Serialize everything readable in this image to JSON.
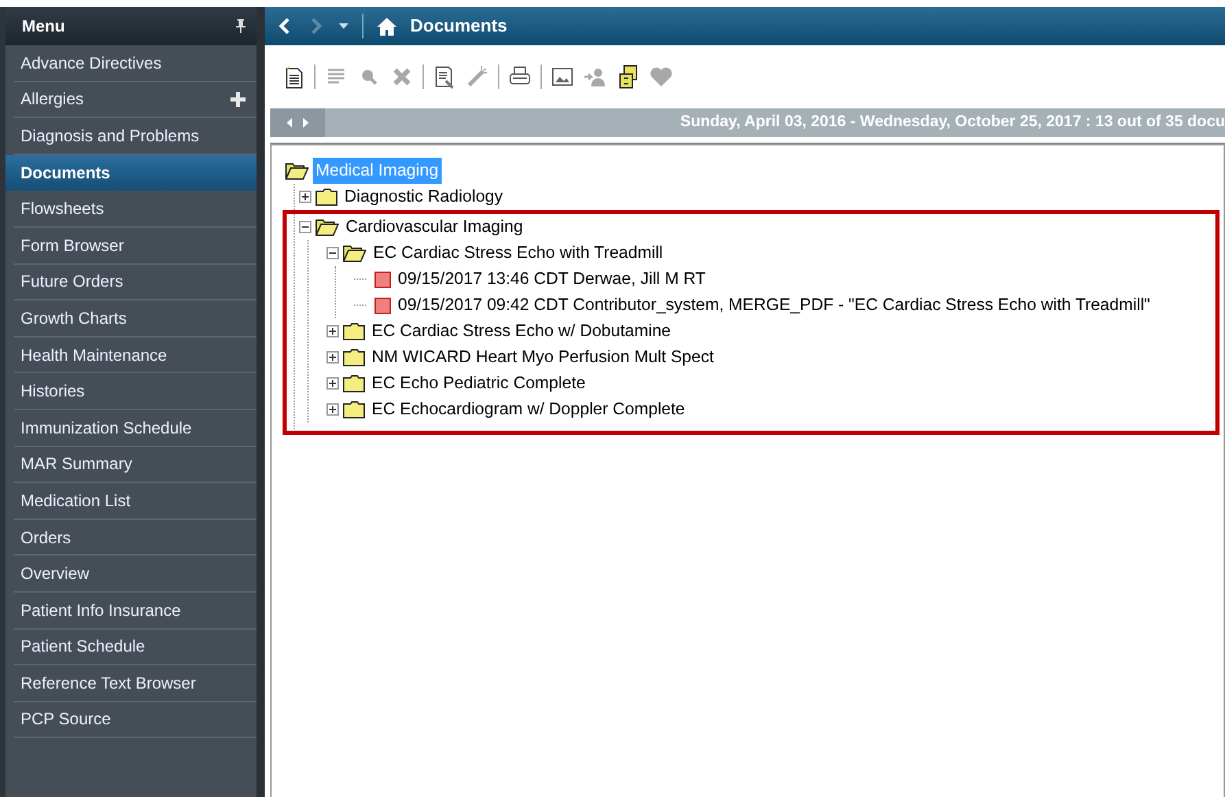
{
  "sidebar": {
    "title": "Menu",
    "items": [
      {
        "label": "Advance Directives",
        "selected": false,
        "addable": false
      },
      {
        "label": "Allergies",
        "selected": false,
        "addable": true
      },
      {
        "label": "Diagnosis and Problems",
        "selected": false,
        "addable": false
      },
      {
        "label": "Documents",
        "selected": true,
        "addable": false
      },
      {
        "label": "Flowsheets",
        "selected": false,
        "addable": false
      },
      {
        "label": "Form Browser",
        "selected": false,
        "addable": false
      },
      {
        "label": "Future Orders",
        "selected": false,
        "addable": false
      },
      {
        "label": "Growth Charts",
        "selected": false,
        "addable": false
      },
      {
        "label": "Health Maintenance",
        "selected": false,
        "addable": false
      },
      {
        "label": "Histories",
        "selected": false,
        "addable": false
      },
      {
        "label": "Immunization Schedule",
        "selected": false,
        "addable": false
      },
      {
        "label": "MAR Summary",
        "selected": false,
        "addable": false
      },
      {
        "label": "Medication List",
        "selected": false,
        "addable": false
      },
      {
        "label": "Orders",
        "selected": false,
        "addable": false
      },
      {
        "label": "Overview",
        "selected": false,
        "addable": false
      },
      {
        "label": "Patient Info Insurance",
        "selected": false,
        "addable": false
      },
      {
        "label": "Patient Schedule",
        "selected": false,
        "addable": false
      },
      {
        "label": "Reference Text Browser",
        "selected": false,
        "addable": false
      },
      {
        "label": "PCP Source",
        "selected": false,
        "addable": false
      }
    ]
  },
  "header": {
    "title": "Documents",
    "nav": [
      {
        "kind": "back",
        "disabled": false
      },
      {
        "kind": "forward",
        "disabled": true
      }
    ]
  },
  "toolbar": [
    {
      "kind": "new-document",
      "disabled": false
    },
    {
      "kind": "separator"
    },
    {
      "kind": "list",
      "disabled": true
    },
    {
      "kind": "search",
      "disabled": true
    },
    {
      "kind": "delete",
      "disabled": true
    },
    {
      "kind": "separator"
    },
    {
      "kind": "document",
      "disabled": false
    },
    {
      "kind": "wand",
      "disabled": true
    },
    {
      "kind": "separator"
    },
    {
      "kind": "print",
      "disabled": false
    },
    {
      "kind": "separator"
    },
    {
      "kind": "image",
      "disabled": false
    },
    {
      "kind": "person",
      "disabled": true
    },
    {
      "kind": "cabinet",
      "disabled": false
    },
    {
      "kind": "heart",
      "disabled": true
    }
  ],
  "date_bar": {
    "text": "Sunday, April 03, 2016 - Wednesday, October 25, 2017 : 13 out of 35 docu"
  },
  "tree": [
    {
      "label": "Medical Imaging",
      "kind": "folder",
      "expanded": true,
      "selected": true,
      "highlighted": false,
      "children": [
        {
          "label": "Diagnostic Radiology",
          "kind": "folder",
          "expanded": false,
          "selected": false,
          "highlighted": false
        },
        {
          "label": "Cardiovascular Imaging",
          "kind": "folder",
          "expanded": true,
          "selected": false,
          "highlighted": true,
          "children": [
            {
              "label": "EC Cardiac Stress Echo with Treadmill",
              "kind": "folder",
              "expanded": true,
              "selected": false,
              "highlighted": false,
              "children": [
                {
                  "label": "09/15/2017 13:46 CDT Derwae, Jill M RT",
                  "kind": "document",
                  "selected": false,
                  "highlighted": false
                },
                {
                  "label": "09/15/2017 09:42 CDT Contributor_system, MERGE_PDF  - \"EC Cardiac Stress Echo with Treadmill\"",
                  "kind": "document",
                  "selected": false,
                  "highlighted": false
                }
              ]
            },
            {
              "label": "EC Cardiac Stress Echo w/ Dobutamine",
              "kind": "folder",
              "expanded": false,
              "selected": false,
              "highlighted": false
            },
            {
              "label": "NM WICARD Heart Myo Perfusion Mult Spect",
              "kind": "folder",
              "expanded": false,
              "selected": false,
              "highlighted": false
            },
            {
              "label": "EC Echo Pediatric Complete",
              "kind": "folder",
              "expanded": false,
              "selected": false,
              "highlighted": false
            },
            {
              "label": "EC Echocardiogram w/ Doppler Complete",
              "kind": "folder",
              "expanded": false,
              "selected": false,
              "highlighted": false
            }
          ]
        }
      ]
    }
  ]
}
